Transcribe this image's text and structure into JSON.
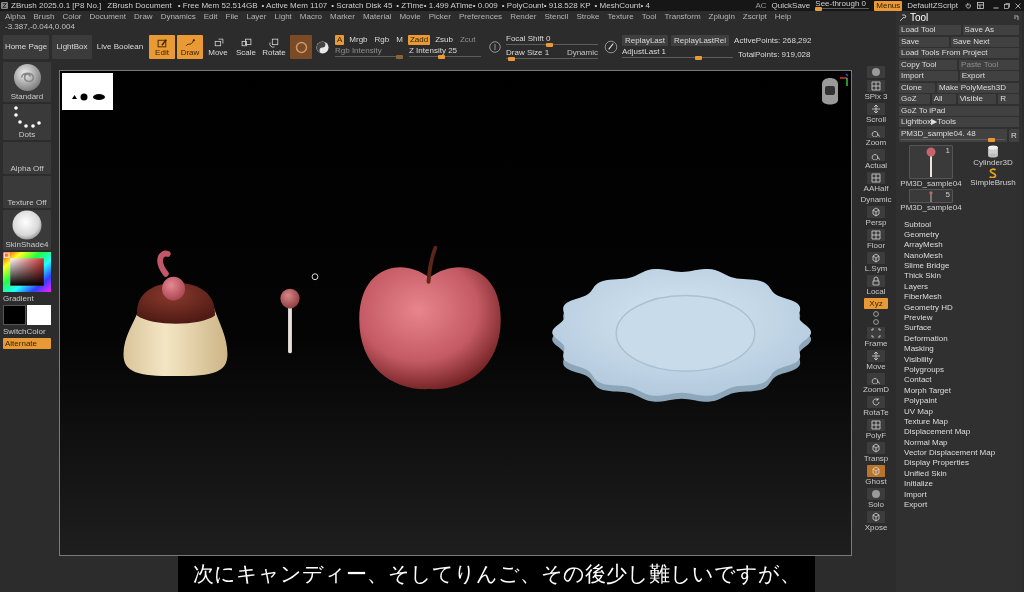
{
  "title_bar": {
    "title": "ZBrush 2025.0.1 [P8 No.]",
    "document": "ZBrush Document",
    "stats": [
      "• Free Mem 52.514GB",
      "• Active Mem 1107",
      "• Scratch Disk 45",
      "• ZTime• 1.499 ATime• 0.009",
      "• PolyCount• 918.528 KP",
      "• MeshCount• 4"
    ],
    "ac": "AC",
    "quicksave": "QuickSave",
    "see_through": {
      "label": "See-through 0",
      "level": 0
    },
    "menus": {
      "label": "Menus",
      "on": true
    },
    "script": "DefaultZScript"
  },
  "menu_bar": [
    "Alpha",
    "Brush",
    "Color",
    "Document",
    "Draw",
    "Dynamics",
    "Edit",
    "File",
    "Layer",
    "Light",
    "Macro",
    "Marker",
    "Material",
    "Movie",
    "Picker",
    "Preferences",
    "Render",
    "Stencil",
    "Stroke",
    "Texture",
    "Tool",
    "Transform",
    "Zplugin",
    "Zscript",
    "Help"
  ],
  "coordinates": "-3.387,-0.044,0.004",
  "top_shelf": {
    "home_page": "Home Page",
    "lightbox": "LightBox",
    "live_boolean": "Live Boolean",
    "modes": [
      {
        "label": "Edit",
        "selected": true
      },
      {
        "label": "Draw",
        "selected": true
      },
      {
        "label": "Move",
        "selected": false
      },
      {
        "label": "Scale",
        "selected": false
      },
      {
        "label": "Rotate",
        "selected": false
      }
    ],
    "channels": [
      {
        "label": "A",
        "selected": true,
        "disabled": false
      },
      {
        "label": "Mrgb",
        "selected": false,
        "disabled": false
      },
      {
        "label": "Rgb",
        "selected": false,
        "disabled": false
      },
      {
        "label": "M",
        "selected": false,
        "disabled": false
      },
      {
        "label": "Zadd",
        "selected": true,
        "disabled": false
      },
      {
        "label": "Zsub",
        "selected": false,
        "disabled": false
      },
      {
        "label": "Zcut",
        "selected": false,
        "disabled": true
      }
    ],
    "intensity_sliders": [
      {
        "label": "Rgb Intensity",
        "level": 1,
        "disabled": true
      },
      {
        "label": "Z Intensity 25",
        "level": 0.45,
        "disabled": false
      }
    ],
    "focal_shift": {
      "label": "Focal Shift 0",
      "level": 0.47
    },
    "draw_size": {
      "label": "Draw Size 1",
      "level": 0.02
    },
    "dynamic": "Dynamic",
    "replay_buttons": [
      "ReplayLast",
      "ReplayLastRel"
    ],
    "active_points": "ActivePoints: 268,292",
    "adjust_last": {
      "label": "AdjustLast 1",
      "level": 0.7
    },
    "total_points": "TotalPoints: 919,028"
  },
  "left_shelf": {
    "brush": "Standard",
    "stroke": "Dots",
    "alpha": "Alpha Off",
    "texture": "Texture Off",
    "material": "SkinShade4",
    "gradient": "Gradient",
    "switch_color": "SwitchColor",
    "alternate": "Alternate"
  },
  "viewport": {
    "models": [
      {
        "kind": "pudding"
      },
      {
        "kind": "lollipop"
      },
      {
        "kind": "apple"
      },
      {
        "kind": "plate"
      }
    ]
  },
  "right_shelf": [
    {
      "kind": "icon",
      "on": false
    },
    {
      "kind": "icon",
      "label": "SPix 3",
      "on": false
    },
    {
      "kind": "icon",
      "label": "Scroll",
      "on": false
    },
    {
      "kind": "icon",
      "label": "Zoom",
      "on": false
    },
    {
      "kind": "icon",
      "label": "Actual",
      "on": false
    },
    {
      "kind": "icon",
      "label": "AAHalf",
      "on": false
    },
    {
      "kind": "text",
      "label": "Dynamic",
      "on": false
    },
    {
      "kind": "icon",
      "label": "Persp",
      "on": false
    },
    {
      "kind": "icon",
      "label": "Floor",
      "on": false
    },
    {
      "kind": "icon",
      "label": "L.Sym",
      "on": false
    },
    {
      "kind": "icon",
      "label": "Local",
      "on": false
    },
    {
      "kind": "toggle",
      "label": "Xyz",
      "on": true
    },
    {
      "kind": "mini",
      "on": false
    },
    {
      "kind": "mini",
      "on": false
    },
    {
      "kind": "icon",
      "label": "Frame",
      "on": false
    },
    {
      "kind": "icon",
      "label": "Move",
      "on": false
    },
    {
      "kind": "icon",
      "label": "ZoomD",
      "on": false
    },
    {
      "kind": "icon",
      "label": "RotaTe",
      "on": false
    },
    {
      "kind": "icon",
      "label": "PolyF",
      "on": false
    },
    {
      "kind": "icon",
      "label": "Transp",
      "on": false
    },
    {
      "kind": "icon",
      "label": "Ghost",
      "on": true
    },
    {
      "kind": "icon",
      "label": "Solo",
      "on": false
    },
    {
      "kind": "icon",
      "label": "Xpose",
      "on": false
    }
  ],
  "tool_panel": {
    "title": "Tool",
    "rows": [
      [
        {
          "label": "Load Tool",
          "disabled": false
        },
        {
          "label": "Save As",
          "disabled": false
        }
      ],
      [
        {
          "label": "Save",
          "disabled": false
        },
        {
          "label": "Save Next",
          "disabled": false
        }
      ],
      [
        {
          "label": "Load Tools From Project",
          "disabled": false
        }
      ],
      [
        {
          "label": "Copy Tool",
          "disabled": false
        },
        {
          "label": "Paste Tool",
          "disabled": true
        }
      ],
      [
        {
          "label": "Import",
          "disabled": false
        },
        {
          "label": "Export",
          "disabled": false
        }
      ],
      [
        {
          "label": "Clone",
          "disabled": false
        },
        {
          "label": "Make PolyMesh3D",
          "disabled": false
        }
      ],
      [
        {
          "label": "GoZ",
          "disabled": false
        },
        {
          "label": "All",
          "disabled": false
        },
        {
          "label": "Visible",
          "disabled": false
        },
        {
          "label": "R",
          "disabled": false
        }
      ],
      [
        {
          "label": "GoZ To iPad",
          "disabled": false
        }
      ],
      [
        {
          "label": "Lightbox▶Tools",
          "disabled": false
        }
      ]
    ],
    "subtool_slider": {
      "label": "PM3D_sample04. 48",
      "level": 0.9
    },
    "slider_button": "R",
    "thumbnails": [
      {
        "label": "PM3D_sample04",
        "count": "1"
      },
      {
        "label": "Cylinder3D"
      },
      {
        "label": "SimpleBrush"
      },
      {
        "label": "PM3D_sample04",
        "count": "5"
      }
    ],
    "sections": [
      "Subtool",
      "Geometry",
      "ArrayMesh",
      "NanoMesh",
      "Slime Bridge",
      "Thick Skin",
      "Layers",
      "FiberMesh",
      "Geometry HD",
      "Preview",
      "Surface",
      "Deformation",
      "Masking",
      "Visibility",
      "Polygroups",
      "Contact",
      "Morph Target",
      "Polypaint",
      "UV Map",
      "Texture Map",
      "Displacement Map",
      "Normal Map",
      "Vector Displacement Map",
      "Display Properties",
      "Unified Skin",
      "Initialize",
      "Import",
      "Export"
    ]
  },
  "subtitle": "次にキャンディー、そしてりんご、その後少し難しいですが、"
}
